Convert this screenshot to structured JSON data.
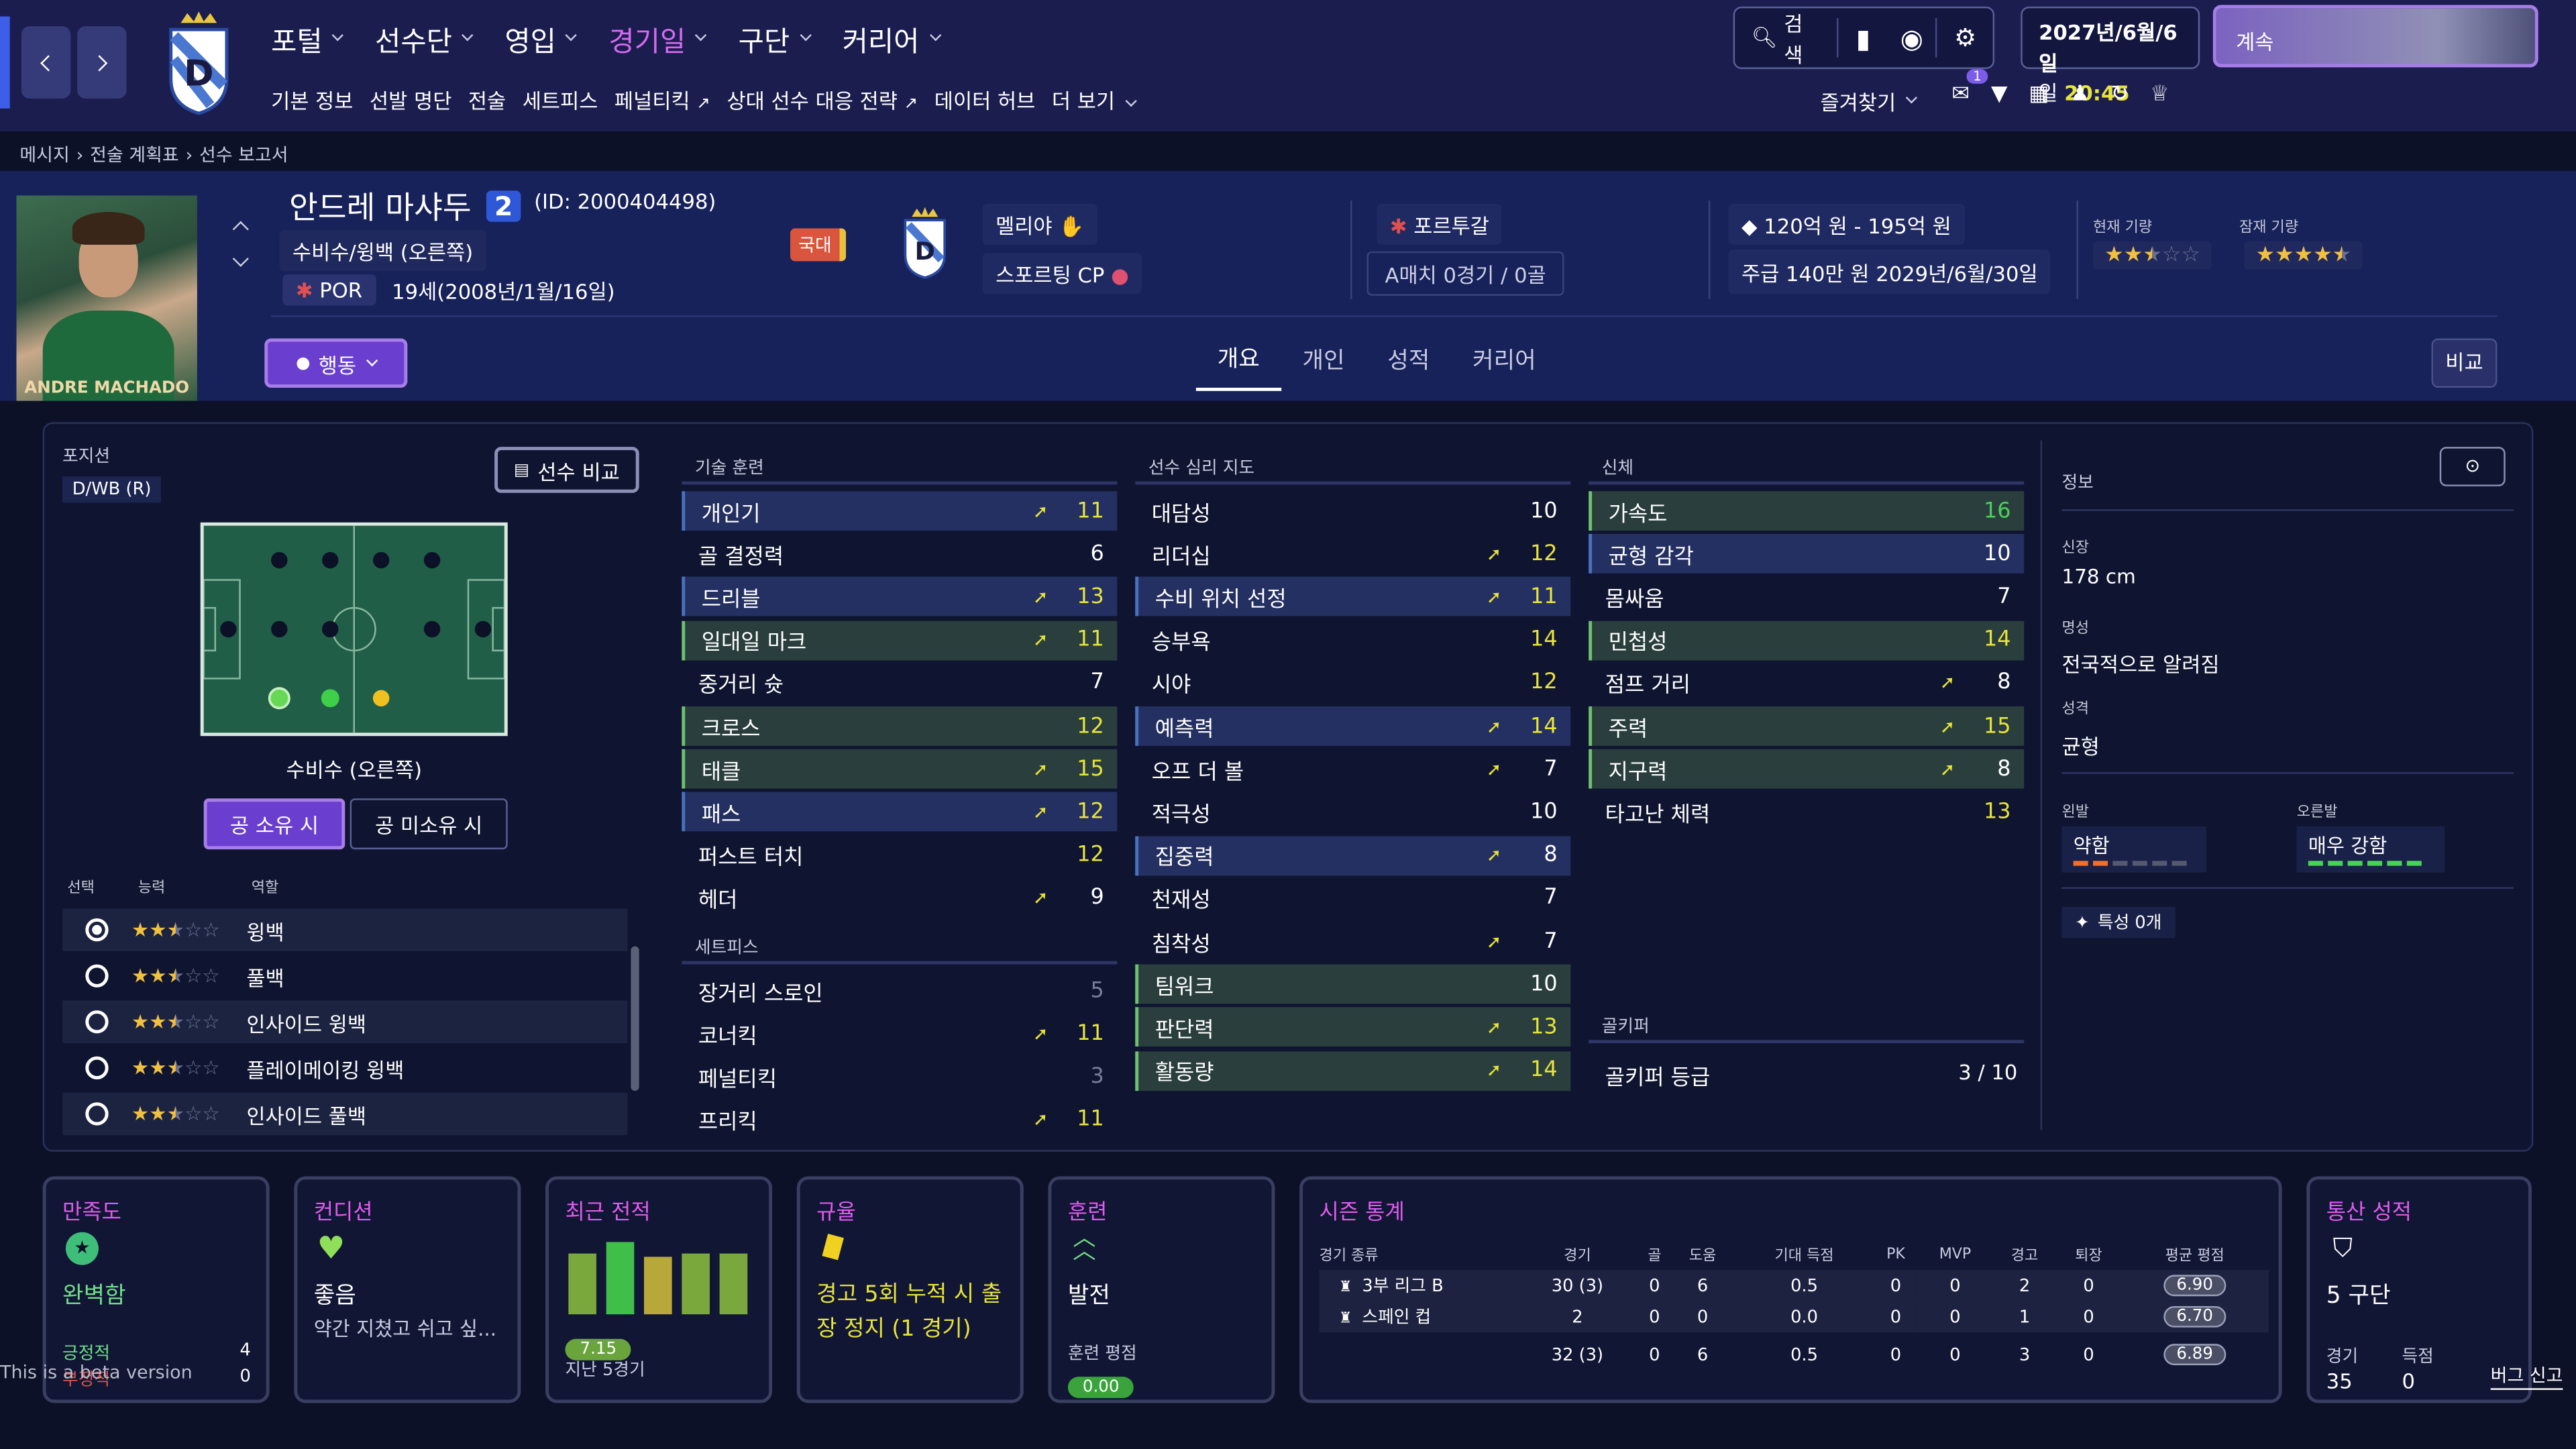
{
  "topbar": {
    "nav": [
      "포털",
      "선수단",
      "영입",
      "경기일",
      "구단",
      "커리어"
    ],
    "active_nav": "경기일",
    "subnav": [
      "기본 정보",
      "선발 명단",
      "전술",
      "세트피스",
      "페널티킥",
      "상대 선수 대응 전략",
      "데이터 허브",
      "더 보기"
    ],
    "search_label": "검색",
    "date": "2027년/6월/6일",
    "weekday": "일",
    "time": "20:45",
    "continue_label": "계속",
    "favorites_label": "즐겨찾기",
    "notif_count": "1"
  },
  "breadcrumb": [
    "메시지",
    "전술 계획표",
    "선수 보고서"
  ],
  "player": {
    "name": "안드레 마샤두",
    "number": "2",
    "id": "(ID: 2000404498)",
    "position_label": "수비수/윙백 (오른쪽)",
    "nat_code": "POR",
    "age": "19세(2008년/1월/16일)",
    "photo_caption": "ANDRE MACHADO",
    "national_badge": "국대",
    "club": "멜리야",
    "loan_club": "스포르팅 CP",
    "country": "포르투갈",
    "caps": "A매치 0경기 / 0골",
    "value": "120억 원 - 195억 원",
    "wage": "주급 140만 원 2029년/6월/30일",
    "current_ability_label": "현재 기량",
    "potential_label": "잠재 기량",
    "current_ability_stars": 2.5,
    "potential_stars": 4.5,
    "action_label": "행동",
    "compare_label": "비교"
  },
  "tabs": [
    "개요",
    "개인",
    "성적",
    "커리어"
  ],
  "active_tab": "개요",
  "position_panel": {
    "title": "포지션",
    "code": "D/WB (R)",
    "compare_button": "선수 비교",
    "pos_name": "수비수 (오른쪽)",
    "in_possession": "공 소유 시",
    "out_possession": "공 미소유 시",
    "col_select": "선택",
    "col_ability": "능력",
    "col_role": "역할",
    "roles": [
      {
        "name": "윙백",
        "stars": 2.5,
        "selected": true
      },
      {
        "name": "풀백",
        "stars": 2.5,
        "selected": false
      },
      {
        "name": "인사이드 윙백",
        "stars": 2.5,
        "selected": false
      },
      {
        "name": "플레이메이킹 윙백",
        "stars": 2.5,
        "selected": false
      },
      {
        "name": "인사이드 풀백",
        "stars": 2.5,
        "selected": false
      }
    ]
  },
  "technical": {
    "title": "기술 훈련",
    "rows": [
      {
        "name": "개인기",
        "value": "11",
        "up": true,
        "hl": "hl",
        "color": "#e8e43a"
      },
      {
        "name": "골 결정력",
        "value": "6",
        "up": false,
        "hl": "",
        "color": "#ffffff"
      },
      {
        "name": "드리블",
        "value": "13",
        "up": true,
        "hl": "hl",
        "color": "#e8e43a"
      },
      {
        "name": "일대일 마크",
        "value": "11",
        "up": true,
        "hl": "gr",
        "color": "#e8e43a"
      },
      {
        "name": "중거리 슛",
        "value": "7",
        "up": false,
        "hl": "",
        "color": "#ffffff"
      },
      {
        "name": "크로스",
        "value": "12",
        "up": false,
        "hl": "gr",
        "color": "#e8e43a"
      },
      {
        "name": "태클",
        "value": "15",
        "up": true,
        "hl": "gr",
        "color": "#e8e43a"
      },
      {
        "name": "패스",
        "value": "12",
        "up": true,
        "hl": "hl",
        "color": "#e8e43a"
      },
      {
        "name": "퍼스트 터치",
        "value": "12",
        "up": false,
        "hl": "",
        "color": "#e8e43a"
      },
      {
        "name": "헤더",
        "value": "9",
        "up": true,
        "hl": "",
        "color": "#ffffff"
      }
    ]
  },
  "setpieces": {
    "title": "세트피스",
    "rows": [
      {
        "name": "장거리 스로인",
        "value": "5",
        "up": false,
        "hl": "",
        "color": "#7a7f99"
      },
      {
        "name": "코너킥",
        "value": "11",
        "up": true,
        "hl": "",
        "color": "#e8e43a"
      },
      {
        "name": "페널티킥",
        "value": "3",
        "up": false,
        "hl": "",
        "color": "#7a7f99"
      },
      {
        "name": "프리킥",
        "value": "11",
        "up": true,
        "hl": "",
        "color": "#e8e43a"
      }
    ]
  },
  "mental": {
    "title": "선수 심리 지도",
    "rows": [
      {
        "name": "대담성",
        "value": "10",
        "up": false,
        "hl": "",
        "color": "#ffffff"
      },
      {
        "name": "리더십",
        "value": "12",
        "up": true,
        "hl": "",
        "color": "#e8e43a"
      },
      {
        "name": "수비 위치 선정",
        "value": "11",
        "up": true,
        "hl": "hl",
        "color": "#e8e43a"
      },
      {
        "name": "승부욕",
        "value": "14",
        "up": false,
        "hl": "",
        "color": "#e8e43a"
      },
      {
        "name": "시야",
        "value": "12",
        "up": false,
        "hl": "",
        "color": "#e8e43a"
      },
      {
        "name": "예측력",
        "value": "14",
        "up": true,
        "hl": "hl",
        "color": "#e8e43a"
      },
      {
        "name": "오프 더 볼",
        "value": "7",
        "up": true,
        "hl": "",
        "color": "#ffffff"
      },
      {
        "name": "적극성",
        "value": "10",
        "up": false,
        "hl": "",
        "color": "#ffffff"
      },
      {
        "name": "집중력",
        "value": "8",
        "up": true,
        "hl": "hl",
        "color": "#ffffff"
      },
      {
        "name": "천재성",
        "value": "7",
        "up": false,
        "hl": "",
        "color": "#ffffff"
      },
      {
        "name": "침착성",
        "value": "7",
        "up": true,
        "hl": "",
        "color": "#ffffff"
      },
      {
        "name": "팀워크",
        "value": "10",
        "up": false,
        "hl": "gr",
        "color": "#ffffff"
      },
      {
        "name": "판단력",
        "value": "13",
        "up": true,
        "hl": "gr",
        "color": "#e8e43a"
      },
      {
        "name": "활동량",
        "value": "14",
        "up": true,
        "hl": "gr",
        "color": "#e8e43a"
      }
    ]
  },
  "physical": {
    "title": "신체",
    "rows": [
      {
        "name": "가속도",
        "value": "16",
        "up": false,
        "hl": "gr",
        "color": "#4bd15a"
      },
      {
        "name": "균형 감각",
        "value": "10",
        "up": false,
        "hl": "hl",
        "color": "#ffffff"
      },
      {
        "name": "몸싸움",
        "value": "7",
        "up": false,
        "hl": "",
        "color": "#ffffff"
      },
      {
        "name": "민첩성",
        "value": "14",
        "up": false,
        "hl": "gr",
        "color": "#e8e43a"
      },
      {
        "name": "점프 거리",
        "value": "8",
        "up": true,
        "hl": "",
        "color": "#ffffff"
      },
      {
        "name": "주력",
        "value": "15",
        "up": true,
        "hl": "gr",
        "color": "#e8e43a"
      },
      {
        "name": "지구력",
        "value": "8",
        "up": true,
        "hl": "gr",
        "color": "#ffffff"
      },
      {
        "name": "타고난 체력",
        "value": "13",
        "up": false,
        "hl": "",
        "color": "#e8e43a"
      }
    ]
  },
  "goalkeeper": {
    "title": "골키퍼",
    "label": "골키퍼 등급",
    "value": "3 / 10"
  },
  "info": {
    "title": "정보",
    "height_label": "신장",
    "height": "178 cm",
    "reputation_label": "명성",
    "reputation": "전국적으로 알려짐",
    "personality_label": "성격",
    "personality": "균형",
    "left_foot_label": "왼발",
    "left_foot": "약함",
    "right_foot_label": "오른발",
    "right_foot": "매우 강함",
    "traits": "특성 0개"
  },
  "cards": {
    "satisfaction": {
      "title": "만족도",
      "value": "완벽함",
      "pos_label": "긍정적",
      "pos": "4",
      "neg_label": "부정적",
      "neg": "0"
    },
    "condition": {
      "title": "컨디션",
      "value": "좋음",
      "desc": "약간 지쳤고 쉬고 싶..."
    },
    "form": {
      "title": "최근 전적",
      "rating": "7.15",
      "label": "지난 5경기",
      "bars": [
        0.75,
        0.88,
        0.7,
        0.75,
        0.75
      ]
    },
    "discipline": {
      "title": "규율",
      "text": "경고 5회 누적 시 출장 정지 (1 경기)"
    },
    "training": {
      "title": "훈련",
      "value": "발전",
      "rating_label": "훈련 평점",
      "rating": "0.00"
    },
    "season": {
      "title": "시즌 통계",
      "headers": [
        "경기 종류",
        "경기",
        "골",
        "도움",
        "기대 득점",
        "PK",
        "MVP",
        "경고",
        "퇴장",
        "평균 평점"
      ],
      "rows": [
        [
          "3부 리그 B",
          "30 (3)",
          "0",
          "6",
          "0.5",
          "0",
          "0",
          "2",
          "0",
          "6.90"
        ],
        [
          "스페인 컵",
          "2",
          "0",
          "0",
          "0.0",
          "0",
          "0",
          "1",
          "0",
          "6.70"
        ]
      ],
      "total": [
        "",
        "32 (3)",
        "0",
        "6",
        "0.5",
        "0",
        "0",
        "3",
        "0",
        "6.89"
      ]
    },
    "career": {
      "title": "통산 성적",
      "value": "5 구단",
      "apps_label": "경기",
      "apps": "35",
      "goals_label": "득점",
      "goals": "0"
    }
  },
  "footer": {
    "beta": "This is a beta version",
    "bug": "버그 신고"
  }
}
